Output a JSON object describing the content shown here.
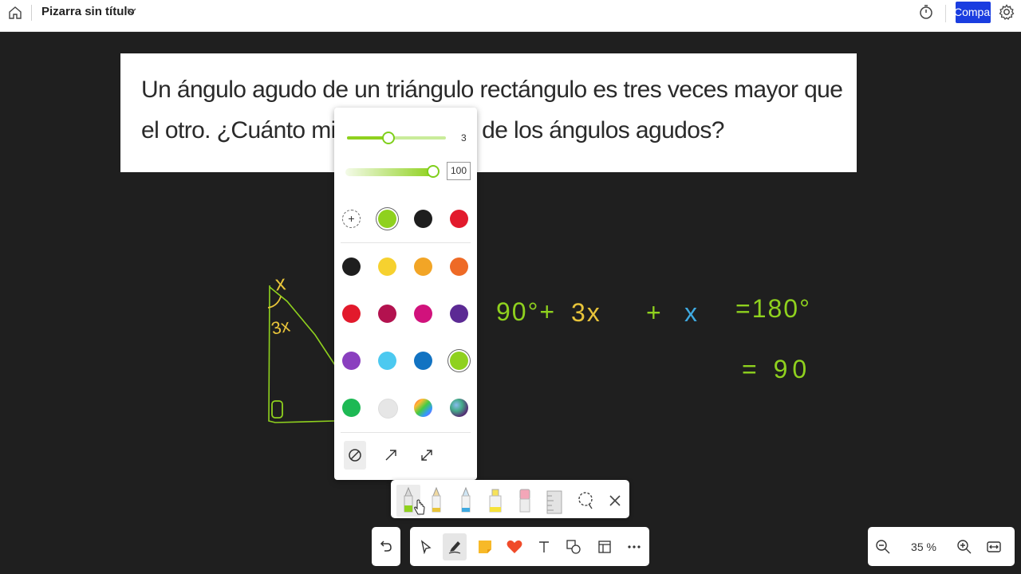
{
  "topbar": {
    "title": "Pizarra sin título",
    "share_label": "Compartir"
  },
  "problem_text": "Un ángulo agudo de un triángulo rectángulo es tres veces mayor que el otro. ¿Cuánto mi- de cada uno de los ángulos agudos?",
  "handwriting": {
    "triangle_labels": [
      "x",
      "3x"
    ],
    "equation_line1": [
      "90°+",
      "3x",
      "+",
      "x",
      "=180°"
    ],
    "equation_line2": "= 90"
  },
  "pen_panel": {
    "thickness_value": "3",
    "thickness_fraction": 0.42,
    "opacity_value": "100",
    "opacity_fraction": 1.0,
    "recent_colors": [
      "#8fd11e",
      "#1e1e1e",
      "#e21a2c"
    ],
    "palette": [
      "#1e1e1e",
      "#f6d12f",
      "#f2a526",
      "#ee6a26",
      "#e21a2c",
      "#b3124f",
      "#d1127c",
      "#5c2a94",
      "#8a3fbf",
      "#4cc9f0",
      "#1273c2",
      "#8fd11e",
      "#1db954",
      "#e6e6e6",
      "rainbow",
      "galaxy"
    ],
    "selected_color": "#8fd11e",
    "end_caps": [
      "no-arrow-icon",
      "arrow-end-icon",
      "arrow-both-icon"
    ]
  },
  "pen_tools": [
    "pen-green-icon",
    "pencil-yellow-icon",
    "pen-blue-icon",
    "highlighter-yellow-icon",
    "eraser-icon",
    "ruler-icon",
    "lasso-icon",
    "close-icon"
  ],
  "main_tools": [
    "undo-icon",
    "select-icon",
    "pen-icon",
    "sticky-note-icon",
    "reaction-icon",
    "text-icon",
    "shapes-icon",
    "template-icon",
    "more-icon"
  ],
  "zoom": {
    "level": "35 %"
  },
  "colors": {
    "accent_green": "#8fd11e",
    "ink_yellow": "#e8c43a",
    "ink_blue": "#3fa9e0",
    "share_blue": "#1a3de0",
    "canvas_bg": "#1f1f1f"
  }
}
